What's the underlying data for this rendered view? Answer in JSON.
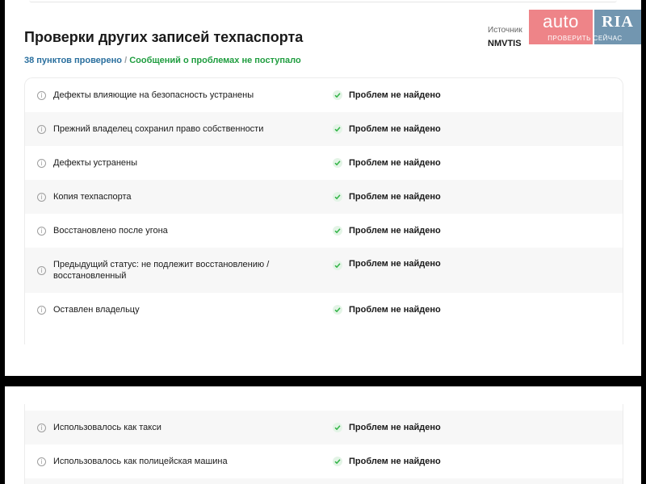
{
  "header": {
    "title": "Проверки других записей техпаспорта",
    "checked_count": "38 пунктов проверено",
    "separator": "/",
    "no_problems": "Сообщений о проблемах не поступало",
    "source_label": "Источник",
    "source_value": "NMVTIS"
  },
  "checks_top": [
    {
      "label": "Дефекты влияющие на безопасность устранены",
      "status": "Проблем не найдено"
    },
    {
      "label": "Прежний владелец сохранил право собственности",
      "status": "Проблем не найдено"
    },
    {
      "label": "Дефекты устранены",
      "status": "Проблем не найдено"
    },
    {
      "label": "Копия техпаспорта",
      "status": "Проблем не найдено"
    },
    {
      "label": "Восстановлено после угона",
      "status": "Проблем не найдено"
    },
    {
      "label": "Предыдущий статус: не подлежит восстановлению / восстановленный",
      "status": "Проблем не найдено"
    },
    {
      "label": "Оставлен владельцу",
      "status": "Проблем не найдено"
    }
  ],
  "checks_bottom": [
    {
      "label": "Использовалось как такси",
      "status": "Проблем не найдено"
    },
    {
      "label": "Использовалось как полицейская машина",
      "status": "Проблем не найдено"
    }
  ],
  "watermark": {
    "brand_left": "auto",
    "brand_right": "RIA",
    "caption": "ПРОВЕРИТЬ СЕЙЧАС"
  },
  "icons": {
    "info": "info-circle-icon",
    "check": "checkmark-icon"
  },
  "colors": {
    "count_blue": "#2a6f9e",
    "ok_green": "#1f9d3f",
    "check_green": "#2fb344"
  }
}
